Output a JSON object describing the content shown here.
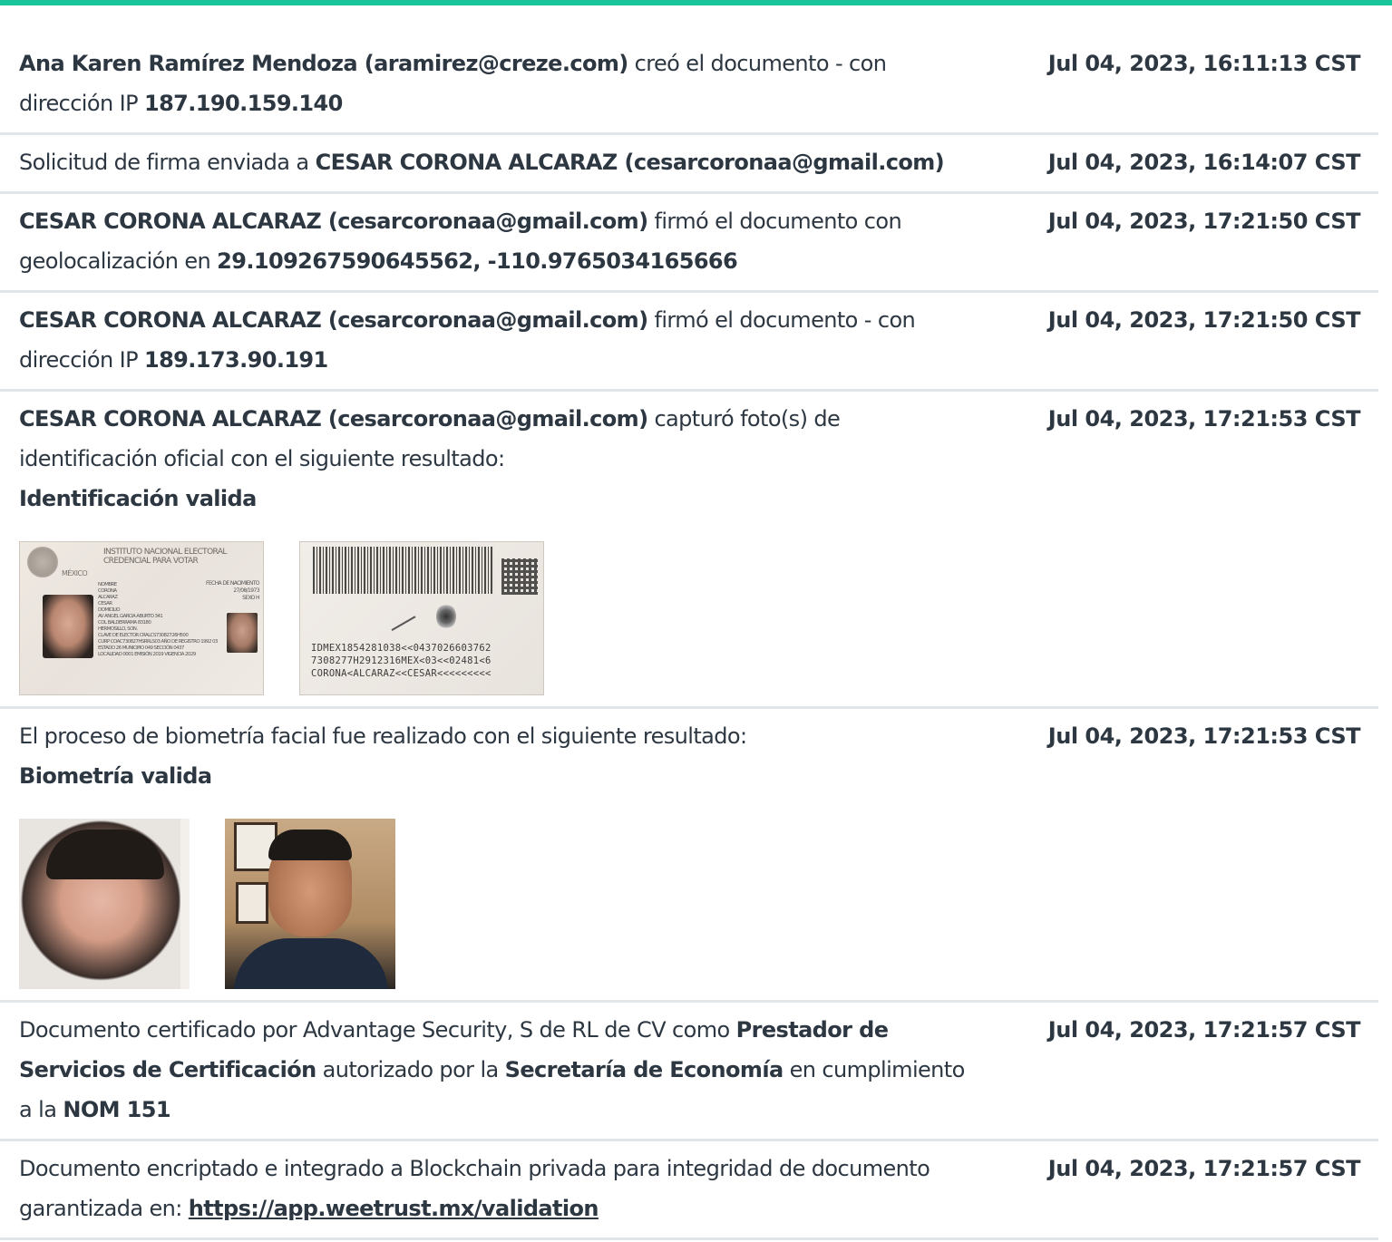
{
  "colors": {
    "accent": "#1ac49a",
    "text": "#2d3742",
    "divider": "#e3e6e9"
  },
  "events": [
    {
      "parts": [
        {
          "t": "Ana Karen Ramírez Mendoza (aramirez@creze.com)",
          "b": true
        },
        {
          "t": " creó el documento - con dirección IP ",
          "b": false
        },
        {
          "t": "187.190.159.140",
          "b": true
        }
      ],
      "time": "Jul 04, 2023, 16:11:13 CST"
    },
    {
      "parts": [
        {
          "t": "Solicitud de firma enviada a ",
          "b": false
        },
        {
          "t": "CESAR CORONA ALCARAZ (cesarcoronaa@gmail.com)",
          "b": true
        }
      ],
      "time": "Jul 04, 2023, 16:14:07 CST"
    },
    {
      "parts": [
        {
          "t": "CESAR CORONA ALCARAZ (cesarcoronaa@gmail.com)",
          "b": true
        },
        {
          "t": " firmó el documento con geolocalización en ",
          "b": false
        },
        {
          "t": "29.109267590645562, -110.9765034165666",
          "b": true
        }
      ],
      "time": "Jul 04, 2023, 17:21:50 CST"
    },
    {
      "parts": [
        {
          "t": "CESAR CORONA ALCARAZ (cesarcoronaa@gmail.com)",
          "b": true
        },
        {
          "t": " firmó el documento - con dirección IP ",
          "b": false
        },
        {
          "t": "189.173.90.191",
          "b": true
        }
      ],
      "time": "Jul 04, 2023, 17:21:50 CST"
    },
    {
      "parts": [
        {
          "t": "CESAR CORONA ALCARAZ (cesarcoronaa@gmail.com)",
          "b": true
        },
        {
          "t": " capturó foto(s) de identificación oficial con el siguiente resultado:",
          "b": false
        },
        {
          "t": "\n",
          "b": false
        },
        {
          "t": "Identificación valida",
          "b": true
        }
      ],
      "time": "Jul 04, 2023, 17:21:53 CST"
    },
    {
      "parts": [
        {
          "t": "El proceso de biometría facial fue realizado con el siguiente resultado:",
          "b": false
        },
        {
          "t": "\n",
          "b": false
        },
        {
          "t": "Biometría valida",
          "b": true
        }
      ],
      "time": "Jul 04, 2023, 17:21:53 CST"
    },
    {
      "parts": [
        {
          "t": "Documento certificado por Advantage Security, S de RL de CV como ",
          "b": false
        },
        {
          "t": "Prestador de Servicios de Certificación",
          "b": true
        },
        {
          "t": " autorizado por la ",
          "b": false
        },
        {
          "t": "Secretaría de Economía",
          "b": true
        },
        {
          "t": " en cumplimiento a la ",
          "b": false
        },
        {
          "t": "NOM 151",
          "b": true
        }
      ],
      "time": "Jul 04, 2023, 17:21:57 CST"
    },
    {
      "parts": [
        {
          "t": "Documento encriptado e integrado a Blockchain privada para integridad de documento garantizada en: ",
          "b": false
        },
        {
          "t": "https://app.weetrust.mx/validation",
          "b": true,
          "link": true
        }
      ],
      "time": "Jul 04, 2023, 17:21:57 CST"
    }
  ],
  "id_front": {
    "country": "MÉXICO",
    "institution": "INSTITUTO NACIONAL ELECTORAL",
    "card_title": "CREDENCIAL PARA VOTAR",
    "fields": [
      "NOMBRE",
      "CORONA",
      "ALCARAZ",
      "CESAR",
      "DOMICILIO",
      "AV ANGEL GARCIA ABURTO 341",
      "COL BALDERRAMA 83180",
      "HERMOSILLO, SON.",
      "CLAVE DE ELECTOR CRALCS73082726H500",
      "CURP COAC730827HSRRLS03   AÑO DE REGISTRO 1992 03",
      "ESTADO 26   MUNICIPIO 049   SECCIÓN 0437",
      "LOCALIDAD 0001   EMISIÓN 2019   VIGENCIA 2029"
    ],
    "dob_label": "FECHA DE NACIMIENTO",
    "dob": "27/08/1973",
    "sex": "SEXO H"
  },
  "id_back": {
    "mrz": [
      "IDMEX1854281038<<0437026603762",
      "7308277H2912316MEX<03<<02481<6",
      "CORONA<ALCARAZ<<CESAR<<<<<<<<<"
    ]
  }
}
